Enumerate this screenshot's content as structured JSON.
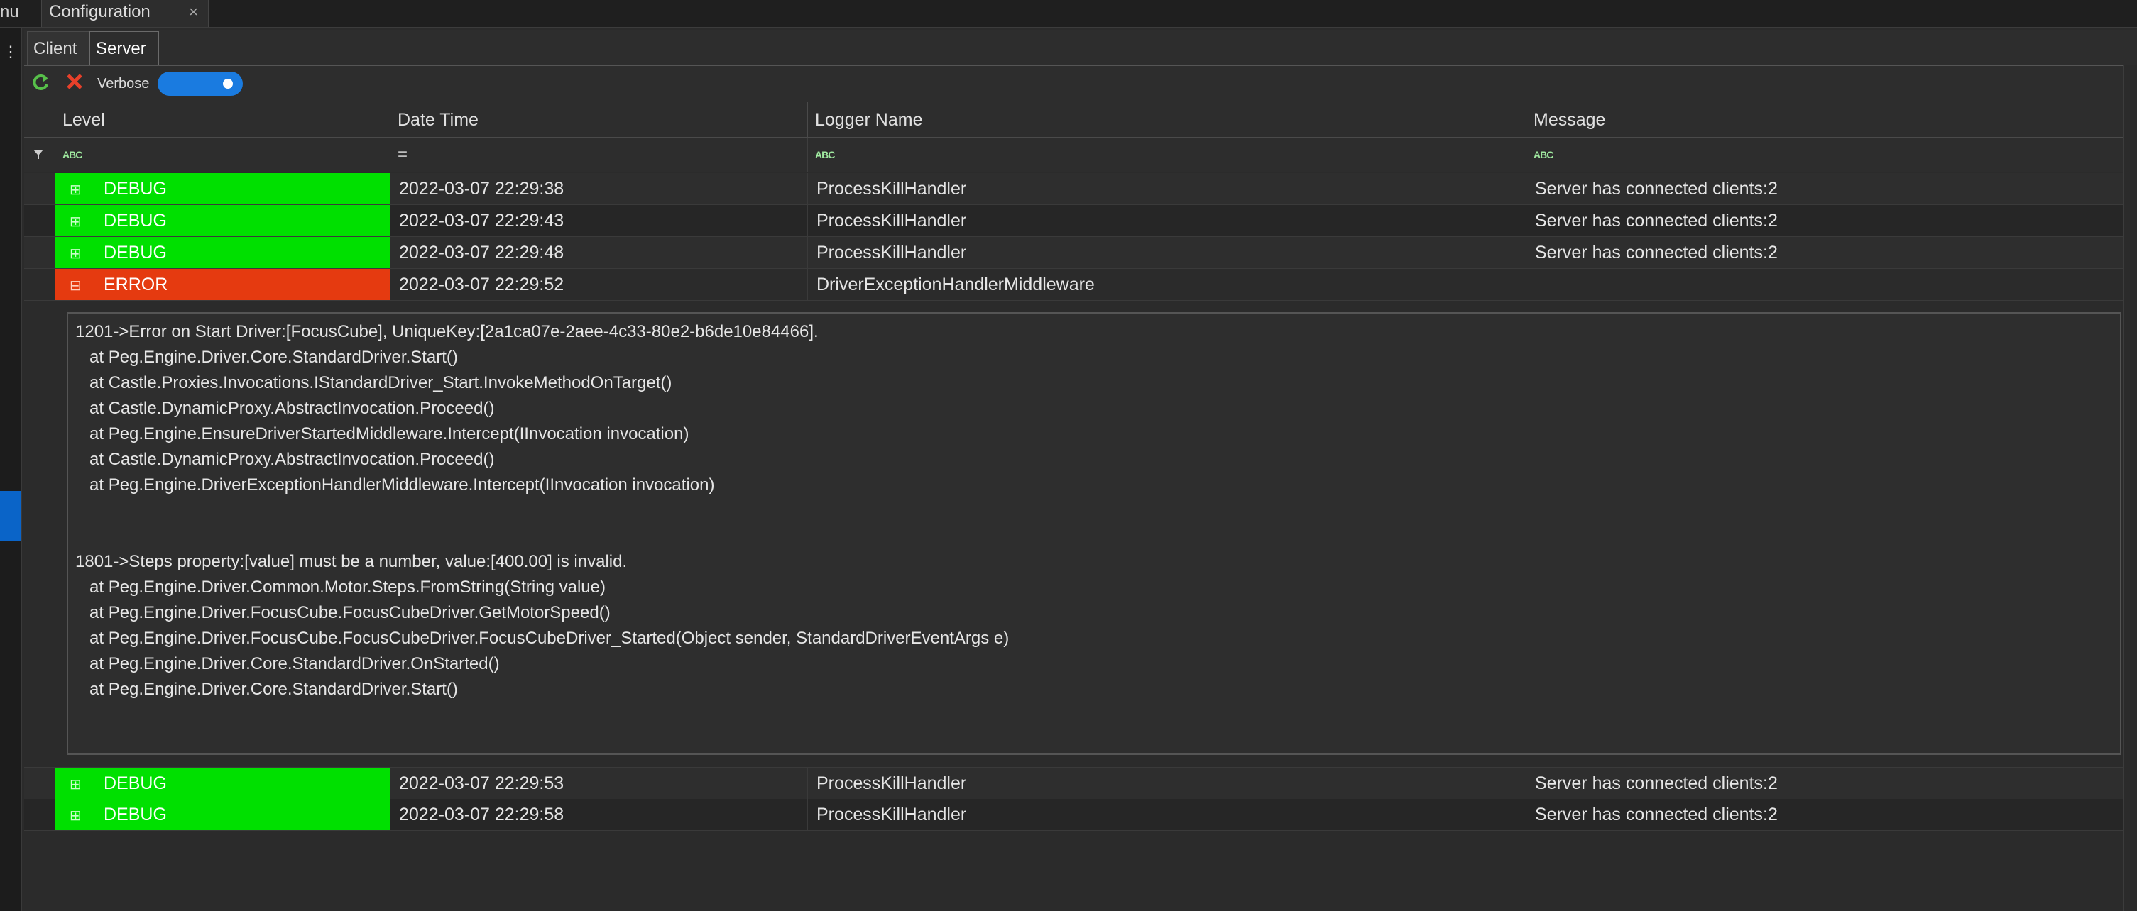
{
  "window": {
    "cut_tab_label": "nu",
    "active_tab_label": "Configuration",
    "close_glyph": "×"
  },
  "left_strip": {
    "glyph": "⋮"
  },
  "sub_tabs": [
    {
      "label": "Client",
      "active": false
    },
    {
      "label": "Server",
      "active": true
    }
  ],
  "toolbar": {
    "refresh_icon": "refresh-icon",
    "clear_icon": "clear-icon",
    "verbose_label": "Verbose",
    "verbose_on": true,
    "accent_color": "#1a7be0"
  },
  "grid": {
    "columns": [
      "Level",
      "Date Time",
      "Logger Name",
      "Message"
    ],
    "filters": {
      "level": "ABC",
      "date_time": "=",
      "logger": "ABC",
      "message": "ABC"
    },
    "colors": {
      "debug": "#00e000",
      "error": "#e53a10"
    },
    "rows_top": [
      {
        "expander": "⊞",
        "level": "DEBUG",
        "date_time": "2022-03-07 22:29:38",
        "logger": "ProcessKillHandler",
        "message": "Server has connected clients:2"
      },
      {
        "expander": "⊞",
        "level": "DEBUG",
        "date_time": "2022-03-07 22:29:43",
        "logger": "ProcessKillHandler",
        "message": "Server has connected clients:2"
      },
      {
        "expander": "⊞",
        "level": "DEBUG",
        "date_time": "2022-03-07 22:29:48",
        "logger": "ProcessKillHandler",
        "message": "Server has connected clients:2"
      },
      {
        "expander": "⊟",
        "level": "ERROR",
        "date_time": "2022-03-07 22:29:52",
        "logger": "DriverExceptionHandlerMiddleware",
        "message": ""
      }
    ],
    "row_arrow": "▸",
    "detail_lines": [
      "1201->Error on Start Driver:[FocusCube], UniqueKey:[2a1ca07e-2aee-4c33-80e2-b6de10e84466].",
      "   at Peg.Engine.Driver.Core.StandardDriver.Start()",
      "   at Castle.Proxies.Invocations.IStandardDriver_Start.InvokeMethodOnTarget()",
      "   at Castle.DynamicProxy.AbstractInvocation.Proceed()",
      "   at Peg.Engine.EnsureDriverStartedMiddleware.Intercept(IInvocation invocation)",
      "   at Castle.DynamicProxy.AbstractInvocation.Proceed()",
      "   at Peg.Engine.DriverExceptionHandlerMiddleware.Intercept(IInvocation invocation)",
      "",
      "",
      "1801->Steps property:[value] must be a number, value:[400.00] is invalid.",
      "   at Peg.Engine.Driver.Common.Motor.Steps.FromString(String value)",
      "   at Peg.Engine.Driver.FocusCube.FocusCubeDriver.GetMotorSpeed()",
      "   at Peg.Engine.Driver.FocusCube.FocusCubeDriver.FocusCubeDriver_Started(Object sender, StandardDriverEventArgs e)",
      "   at Peg.Engine.Driver.Core.StandardDriver.OnStarted()",
      "   at Peg.Engine.Driver.Core.StandardDriver.Start()"
    ],
    "rows_bottom": [
      {
        "expander": "⊞",
        "level": "DEBUG",
        "date_time": "2022-03-07 22:29:53",
        "logger": "ProcessKillHandler",
        "message": "Server has connected clients:2"
      },
      {
        "expander": "⊞",
        "level": "DEBUG",
        "date_time": "2022-03-07 22:29:58",
        "logger": "ProcessKillHandler",
        "message": "Server has connected clients:2"
      }
    ]
  }
}
